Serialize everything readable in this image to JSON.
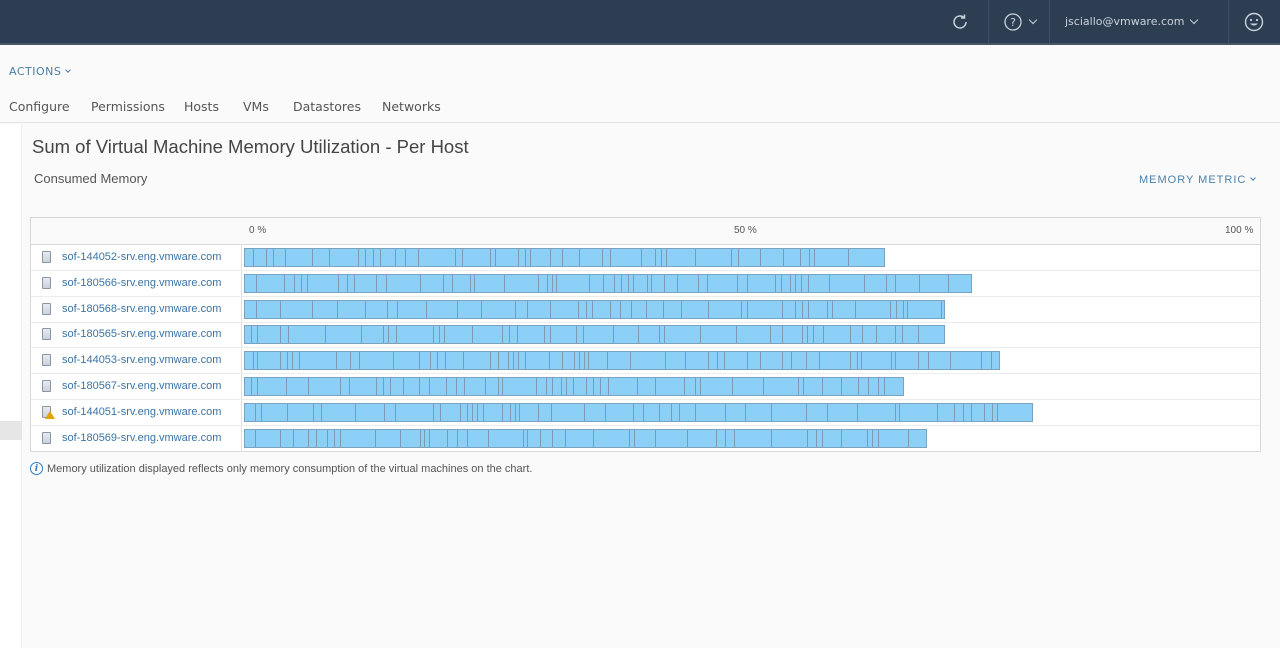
{
  "topbar": {
    "user": "jsciallo@vmware.com",
    "icons": [
      "refresh-icon",
      "help-icon",
      "user-chevron-icon",
      "smiley-feedback-icon"
    ]
  },
  "actions_label": "ACTIONS",
  "tabs": [
    {
      "label": "Configure"
    },
    {
      "label": "Permissions"
    },
    {
      "label": "Hosts"
    },
    {
      "label": "VMs"
    },
    {
      "label": "Datastores"
    },
    {
      "label": "Networks"
    }
  ],
  "page": {
    "title": "Sum of Virtual Machine Memory Utilization - Per Host",
    "subtitle": "Consumed Memory",
    "metric_button": "MEMORY METRIC",
    "info_text": "Memory utilization displayed reflects only memory consumption of the virtual machines on the chart."
  },
  "colors": {
    "bar_fill": "#8ccff7",
    "bar_divider": "#7f9bb3",
    "link": "#3b73a3",
    "topbar": "#2e3e52",
    "warning": "#e2a400"
  },
  "chart_data": {
    "type": "bar",
    "orientation": "horizontal-stacked",
    "title": "Sum of Virtual Machine Memory Utilization - Per Host",
    "subtitle": "Consumed Memory",
    "xlabel": "",
    "ylabel": "",
    "xlim": [
      0,
      100
    ],
    "x_ticks": [
      "0 %",
      "50 %",
      "100 %"
    ],
    "categories": [
      "sof-144052-srv.eng.vmware.com",
      "sof-180566-srv.eng.vmware.com",
      "sof-180568-srv.eng.vmware.com",
      "sof-180565-srv.eng.vmware.com",
      "sof-144053-srv.eng.vmware.com",
      "sof-180567-srv.eng.vmware.com",
      "sof-144051-srv.eng.vmware.com",
      "sof-180569-srv.eng.vmware.com"
    ],
    "values": [
      63.7,
      72.4,
      69.7,
      69.7,
      75.1,
      65.6,
      78.4,
      67.9
    ],
    "host_warning": [
      false,
      false,
      false,
      false,
      false,
      false,
      true,
      false
    ],
    "unit": "%"
  }
}
